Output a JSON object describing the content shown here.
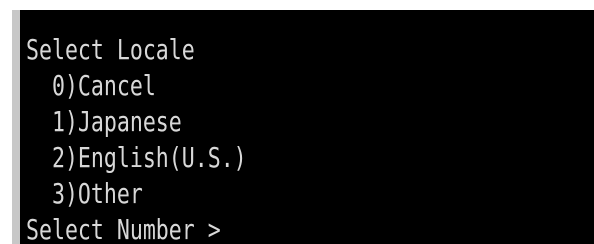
{
  "console": {
    "title": "Select Locale",
    "options": [
      "  0)Cancel",
      "  1)Japanese",
      "  2)English(U.S.)",
      "  3)Other"
    ],
    "prompt": "Select Number >"
  },
  "colors": {
    "background": "#000000",
    "text": "#d8d8d8",
    "frame": "#c7c7c7"
  }
}
